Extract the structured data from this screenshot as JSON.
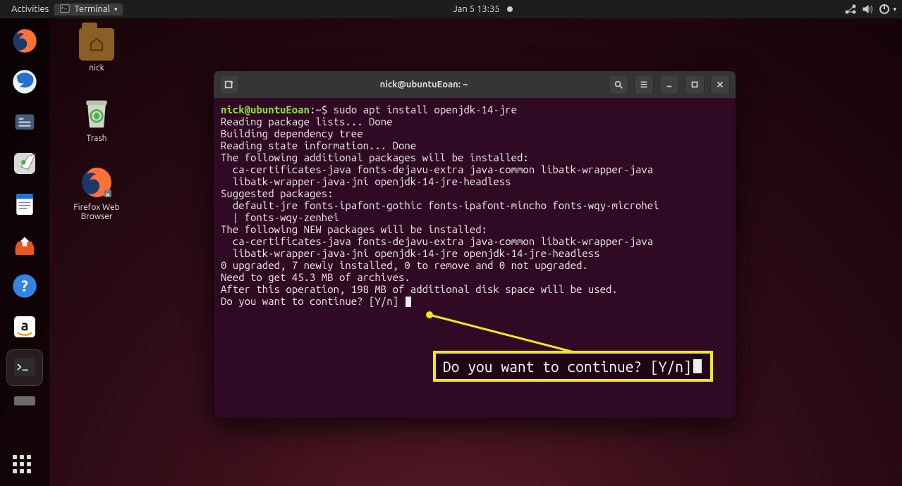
{
  "topbar": {
    "activities": "Activities",
    "app_menu": "Terminal",
    "datetime": "Jan 5  13:35"
  },
  "dock": {
    "items": [
      "firefox",
      "thunderbird",
      "files",
      "rhythmbox",
      "writer",
      "software",
      "help",
      "amazon",
      "terminal"
    ]
  },
  "desktop": {
    "home_label": "nick",
    "trash_label": "Trash",
    "ff_label": "Firefox Web Browser"
  },
  "terminal": {
    "title": "nick@ubuntuEoan: ~",
    "prompt_user": "nick@ubuntuEoan",
    "prompt_sep": ":",
    "prompt_path": "~",
    "prompt_dollar": "$ ",
    "command": "sudo apt install openjdk-14-jre",
    "lines": [
      "Reading package lists... Done",
      "Building dependency tree",
      "Reading state information... Done",
      "The following additional packages will be installed:",
      "  ca-certificates-java fonts-dejavu-extra java-common libatk-wrapper-java",
      "  libatk-wrapper-java-jni openjdk-14-jre-headless",
      "Suggested packages:",
      "  default-jre fonts-ipafont-gothic fonts-ipafont-mincho fonts-wqy-microhei",
      "  | fonts-wqy-zenhei",
      "The following NEW packages will be installed:",
      "  ca-certificates-java fonts-dejavu-extra java-common libatk-wrapper-java",
      "  libatk-wrapper-java-jni openjdk-14-jre openjdk-14-jre-headless",
      "0 upgraded, 7 newly installed, 0 to remove and 0 not upgraded.",
      "Need to get 45.3 MB of archives.",
      "After this operation, 198 MB of additional disk space will be used.",
      "Do you want to continue? [Y/n] "
    ]
  },
  "callout": {
    "text": "Do you want to continue? [Y/n] "
  }
}
